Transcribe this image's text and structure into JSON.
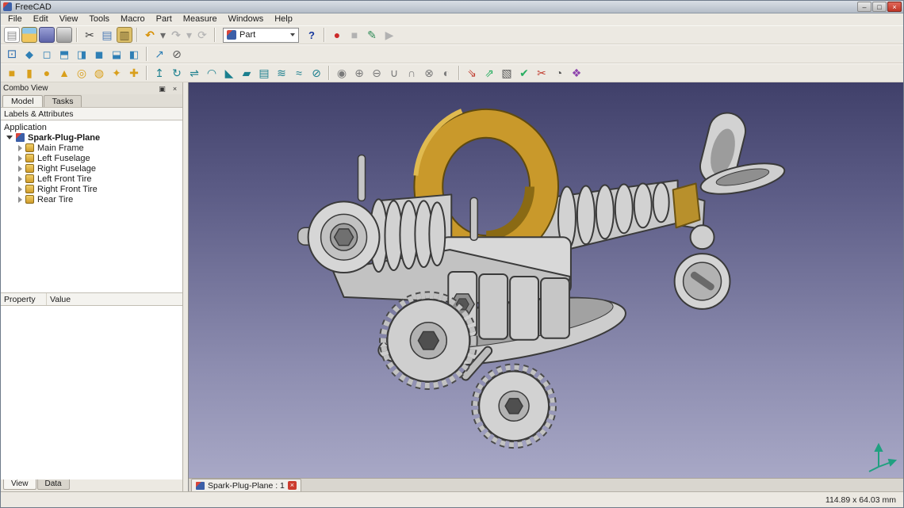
{
  "window": {
    "title": "FreeCAD",
    "minimize_glyph": "–",
    "maximize_glyph": "□",
    "close_glyph": "×"
  },
  "menubar": {
    "items": [
      "File",
      "Edit",
      "View",
      "Tools",
      "Macro",
      "Part",
      "Measure",
      "Windows",
      "Help"
    ]
  },
  "toolbars": {
    "workbench": {
      "selected": "Part"
    },
    "file": {
      "g1": [
        {
          "name": "new-file-icon",
          "glyph": "▤",
          "style": "color:#8a8a8a;background:#ffffff;border:1px solid #9a9a9a"
        },
        {
          "name": "open-file-icon",
          "glyph": "",
          "style": "background:linear-gradient(180deg,#8ec7e8 42%,#f1c75e 42%);border:1px solid #8a7a3a"
        },
        {
          "name": "save-icon",
          "glyph": "",
          "style": "background:linear-gradient(180deg,#9aa0d6,#5d63a8);border:1px solid #44497e"
        },
        {
          "name": "print-icon",
          "glyph": "",
          "style": "background:linear-gradient(180deg,#e2e2e2,#9b9b9b);border:1px solid #7d7d7d"
        }
      ],
      "g2": [
        {
          "name": "cut-icon",
          "glyph": "✂",
          "style": "color:#3a3a3a"
        },
        {
          "name": "copy-icon",
          "glyph": "▤",
          "style": "color:#4a7ab5"
        },
        {
          "name": "paste-icon",
          "glyph": "▥",
          "style": "color:#6a5a2a;background:#ddc06a;border:1px solid #9a823f"
        }
      ],
      "g3": [
        {
          "name": "undo-icon",
          "glyph": "↶",
          "style": "color:#d78f00;font-weight:bold"
        },
        {
          "name": "undo-dropdown-icon",
          "glyph": "▾",
          "style": "color:#6a6a6a;width:9px"
        },
        {
          "name": "redo-icon",
          "glyph": "↷",
          "style": "color:#b2b2b2;font-weight:bold"
        },
        {
          "name": "redo-dropdown-icon",
          "glyph": "▾",
          "style": "color:#b2b2b2;width:9px"
        },
        {
          "name": "refresh-icon",
          "glyph": "⟳",
          "style": "color:#b2b2b2"
        }
      ],
      "g4": [
        {
          "name": "whatsthis-icon",
          "glyph": "?",
          "style": "color:#15379c;font-weight:bold;font-size:13px"
        }
      ],
      "g5": [
        {
          "name": "macro-record-icon",
          "glyph": "●",
          "style": "color:#cc2a2a"
        },
        {
          "name": "macro-stop-icon",
          "glyph": "■",
          "style": "color:#b2b2b2"
        },
        {
          "name": "macro-edit-icon",
          "glyph": "✎",
          "style": "color:#2e8b57"
        },
        {
          "name": "macro-play-icon",
          "glyph": "▶",
          "style": "color:#b2b2b2"
        }
      ]
    },
    "view": {
      "g1": [
        {
          "name": "fit-all-icon",
          "glyph": "⊡",
          "style": "color:#2f6fb0;font-size:15px"
        }
      ],
      "g2": [
        {
          "name": "axonometric-view-icon",
          "glyph": "◆",
          "style": "color:#2f7fb5;font-size:13px"
        },
        {
          "name": "front-view-icon",
          "glyph": "◻",
          "style": "color:#2f7fb5;font-size:13px"
        },
        {
          "name": "top-view-icon",
          "glyph": "⬒",
          "style": "color:#2f7fb5;font-size:13px"
        },
        {
          "name": "right-view-icon",
          "glyph": "◨",
          "style": "color:#2f7fb5;font-size:13px"
        },
        {
          "name": "rear-view-icon",
          "glyph": "◼",
          "style": "color:#2f7fb5;font-size:13px"
        },
        {
          "name": "bottom-view-icon",
          "glyph": "⬓",
          "style": "color:#2f7fb5;font-size:13px"
        },
        {
          "name": "left-view-icon",
          "glyph": "◧",
          "style": "color:#2f7fb5;font-size:13px"
        }
      ],
      "g3": [
        {
          "name": "measure-distance-icon",
          "glyph": "↗",
          "style": "color:#2f7fb5"
        },
        {
          "name": "measure-clear-icon",
          "glyph": "⊘",
          "style": "color:#555555"
        }
      ]
    },
    "part": {
      "g1": [
        {
          "name": "box-icon",
          "glyph": "■",
          "style": "color:#d99f1b"
        },
        {
          "name": "cylinder-icon",
          "glyph": "▮",
          "style": "color:#d99f1b"
        },
        {
          "name": "sphere-icon",
          "glyph": "●",
          "style": "color:#d99f1b"
        },
        {
          "name": "cone-icon",
          "glyph": "▲",
          "style": "color:#d99f1b"
        },
        {
          "name": "torus-icon",
          "glyph": "◎",
          "style": "color:#d99f1b"
        },
        {
          "name": "tube-icon",
          "glyph": "◍",
          "style": "color:#d99f1b"
        },
        {
          "name": "primitives-icon",
          "glyph": "✦",
          "style": "color:#d99f1b"
        },
        {
          "name": "shape-builder-icon",
          "glyph": "✚",
          "style": "color:#d99f1b"
        }
      ],
      "g2": [
        {
          "name": "extrude-icon",
          "glyph": "↥",
          "style": "color:#1b7f8e"
        },
        {
          "name": "revolve-icon",
          "glyph": "↻",
          "style": "color:#1b7f8e"
        },
        {
          "name": "mirror-icon",
          "glyph": "⇌",
          "style": "color:#1b7f8e"
        },
        {
          "name": "fillet-icon",
          "glyph": "◠",
          "style": "color:#1b7f8e"
        },
        {
          "name": "chamfer-icon",
          "glyph": "◣",
          "style": "color:#1b7f8e"
        },
        {
          "name": "make-face-icon",
          "glyph": "▰",
          "style": "color:#1b7f8e"
        },
        {
          "name": "ruled-surface-icon",
          "glyph": "▤",
          "style": "color:#1b7f8e"
        },
        {
          "name": "loft-icon",
          "glyph": "≋",
          "style": "color:#1b7f8e"
        },
        {
          "name": "sweep-icon",
          "glyph": "≈",
          "style": "color:#1b7f8e"
        },
        {
          "name": "section-icon",
          "glyph": "⊘",
          "style": "color:#1b7f8e"
        }
      ],
      "g3": [
        {
          "name": "compound-icon",
          "glyph": "◉",
          "style": "color:#7a7a7a"
        },
        {
          "name": "boolean-icon",
          "glyph": "⊕",
          "style": "color:#7a7a7a"
        },
        {
          "name": "boolean-cut-icon",
          "glyph": "⊖",
          "style": "color:#7a7a7a"
        },
        {
          "name": "union-icon",
          "glyph": "∪",
          "style": "color:#7a7a7a"
        },
        {
          "name": "intersection-icon",
          "glyph": "∩",
          "style": "color:#7a7a7a"
        },
        {
          "name": "connect-icon",
          "glyph": "⊗",
          "style": "color:#7a7a7a"
        },
        {
          "name": "splitter-icon",
          "glyph": "◐",
          "style": "color:#7a7a7a"
        }
      ],
      "g4": [
        {
          "name": "import-cad-icon",
          "glyph": "⇘",
          "style": "color:#c0392b"
        },
        {
          "name": "export-cad-icon",
          "glyph": "⇗",
          "style": "color:#27ae60"
        },
        {
          "name": "box-selection-icon",
          "glyph": "▧",
          "style": "color:#555555"
        },
        {
          "name": "check-geometry-icon",
          "glyph": "✔",
          "style": "color:#27ae60"
        },
        {
          "name": "defeaturing-icon",
          "glyph": "✂",
          "style": "color:#c0392b"
        },
        {
          "name": "thickness-icon",
          "glyph": "◔",
          "style": "color:#555555"
        },
        {
          "name": "refine-shape-icon",
          "glyph": "❖",
          "style": "color:#8e44ad"
        }
      ]
    }
  },
  "combo_view": {
    "title": "Combo View",
    "float_glyph": "▣",
    "close_glyph": "×",
    "tabs": [
      "Model",
      "Tasks"
    ],
    "labels_header": "Labels & Attributes",
    "tree": {
      "application": "Application",
      "root_label": "Spark-Plug-Plane",
      "children": [
        {
          "label": "Main Frame"
        },
        {
          "label": "Left Fuselage"
        },
        {
          "label": "Right Fuselage"
        },
        {
          "label": "Left Front Tire"
        },
        {
          "label": "Right Front Tire"
        },
        {
          "label": "Rear Tire"
        }
      ]
    },
    "property_header": {
      "property": "Property",
      "value": "Value"
    },
    "bottom_tabs": [
      "View",
      "Data"
    ]
  },
  "viewport": {
    "doc_tab_label": "Spark-Plug-Plane : 1",
    "doc_tab_close_glyph": "×"
  },
  "statusbar": {
    "dimensions": "114.89 x 64.03 mm"
  }
}
